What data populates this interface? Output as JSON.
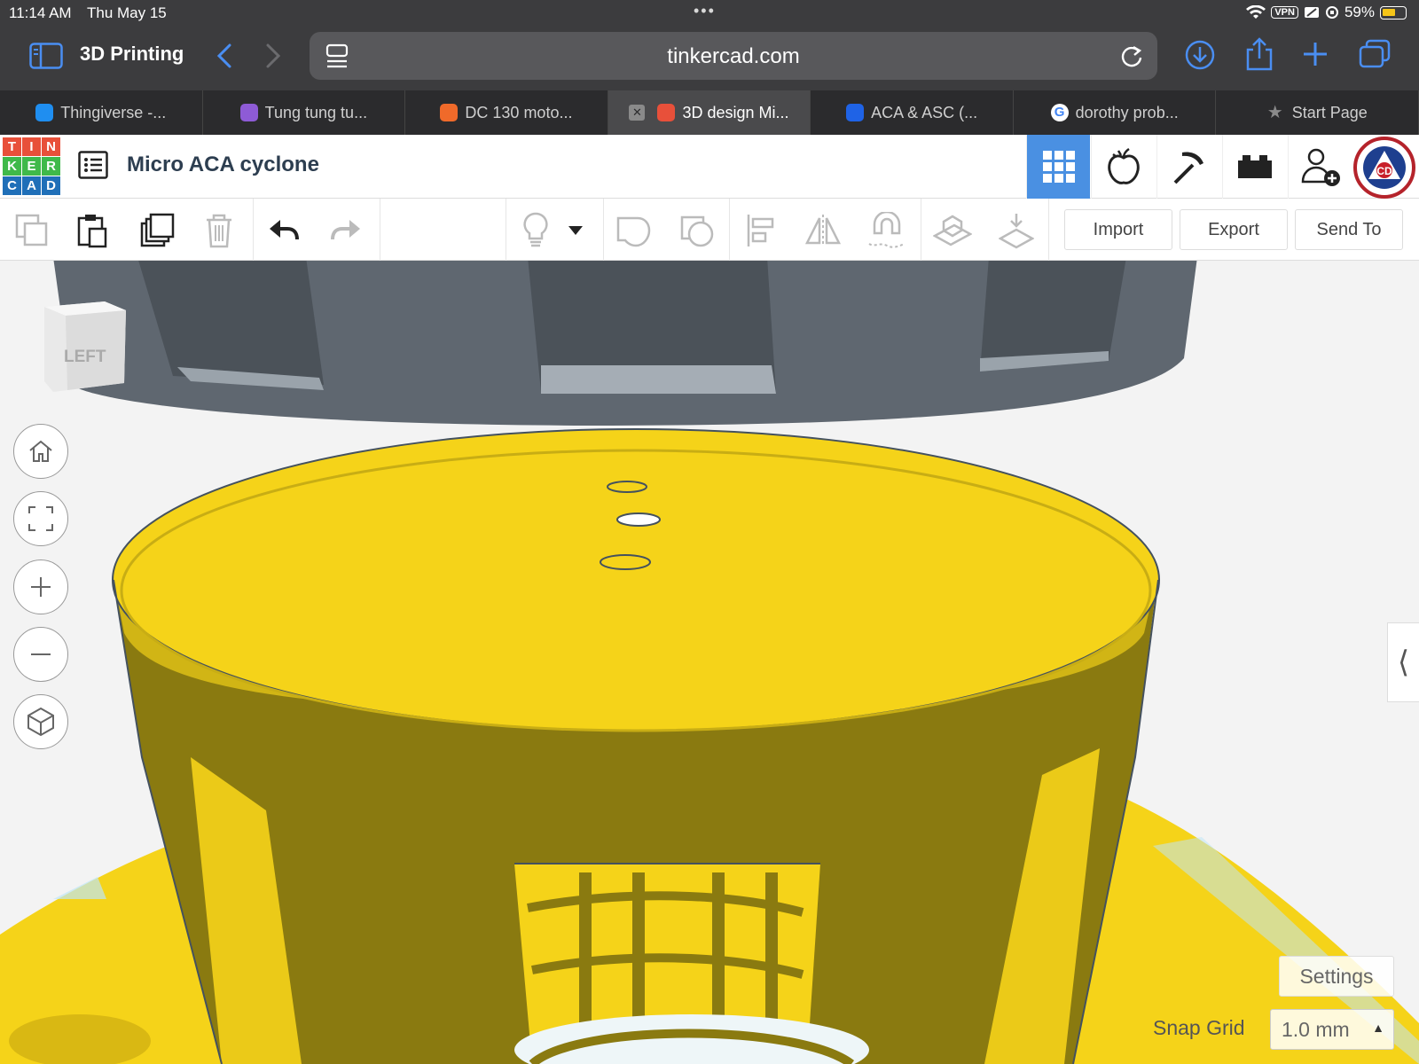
{
  "status_bar": {
    "time": "11:14 AM",
    "date": "Thu May 15",
    "vpn": "VPN",
    "battery": "59%",
    "battery_fraction": 0.59
  },
  "browser": {
    "tab_group": "3D Printing",
    "url": "tinkercad.com",
    "tabs": [
      {
        "label": "Thingiverse -...",
        "icon": "thingiverse-icon",
        "color": "#1f8ef0"
      },
      {
        "label": "Tung tung tu...",
        "icon": "canva-icon",
        "color": "#8e5bd6"
      },
      {
        "label": "DC 130 moto...",
        "icon": "play-icon",
        "color": "#f06a2a"
      },
      {
        "label": "3D design Mi...",
        "icon": "tinkercad-icon",
        "color": "#e8503a",
        "active": true
      },
      {
        "label": "ACA & ASC (...",
        "icon": "dropbox-icon",
        "color": "#1f63e6"
      },
      {
        "label": "dorothy prob...",
        "icon": "google-icon",
        "color": "#ffffff"
      },
      {
        "label": "Start Page",
        "icon": "star-icon",
        "color": "#8a8a8a"
      }
    ]
  },
  "tinkercad": {
    "logo": [
      "T",
      "I",
      "N",
      "K",
      "E",
      "R",
      "C",
      "A",
      "D"
    ],
    "project_title": "Micro ACA cyclone",
    "toolbar": {
      "import": "Import",
      "export": "Export",
      "send_to": "Send To"
    },
    "viewcube_label": "LEFT",
    "settings": "Settings",
    "snap_grid_label": "Snap Grid",
    "snap_grid_value": "1.0 mm"
  },
  "colors": {
    "accent": "#4a90e2",
    "shape_yellow": "#f5d319",
    "shape_gray": "#5c6670",
    "workplane": "#f3f3f3"
  }
}
